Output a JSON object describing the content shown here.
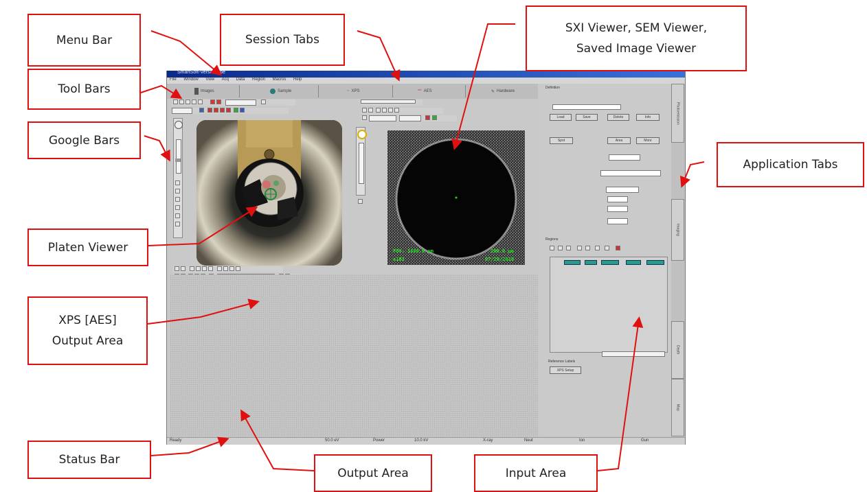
{
  "callouts": {
    "menu_bar": "Menu Bar",
    "tool_bars": "Tool Bars",
    "google_bars": "Google Bars",
    "session_tabs": "Session Tabs",
    "sxi_viewer_line1": "SXI Viewer, SEM Viewer,",
    "sxi_viewer_line2": "Saved Image Viewer",
    "application_tabs": "Application Tabs",
    "platen_viewer": "Platen Viewer",
    "xps_output_line1": "XPS [AES]",
    "xps_output_line2": "Output Area",
    "status_bar": "Status Bar",
    "output_area": "Output Area",
    "input_area": "Input Area"
  },
  "app": {
    "title": "SmartSoft-VersaProbe",
    "menu": [
      "File",
      "Window",
      "View",
      "Acq",
      "Data",
      "Region",
      "Macros",
      "Help"
    ],
    "sessions": [
      "Images",
      "Sample",
      "XPS",
      "AES",
      "Hardware"
    ],
    "sem_readout": {
      "fov": "FOV: 1600.0 µm",
      "scale": "200.0 µm",
      "magnification": "x102",
      "date": "07/29/2010"
    },
    "input": {
      "section": "Definition",
      "buttons_row1": [
        "Load",
        "Save",
        "Delete",
        "Info"
      ],
      "buttons_row2": [
        "Spot",
        "Area",
        "More"
      ],
      "regions_header": "Regions",
      "bottom_label": "Reference Labels",
      "bottom_button": "XPS Setup"
    },
    "app_tabs": [
      "Photoemission",
      "Imaging",
      "Depth",
      "Map"
    ],
    "status": [
      "Ready",
      "50.0 eV",
      "Power",
      "10.0 kV",
      "X-ray",
      "Neut",
      "Ion",
      "Gun"
    ]
  },
  "colors": {
    "callout_border": "#e01010",
    "arrow": "#e01010",
    "title_bar": "#0a2a8a",
    "sem_overlay_text": "#20e020"
  }
}
